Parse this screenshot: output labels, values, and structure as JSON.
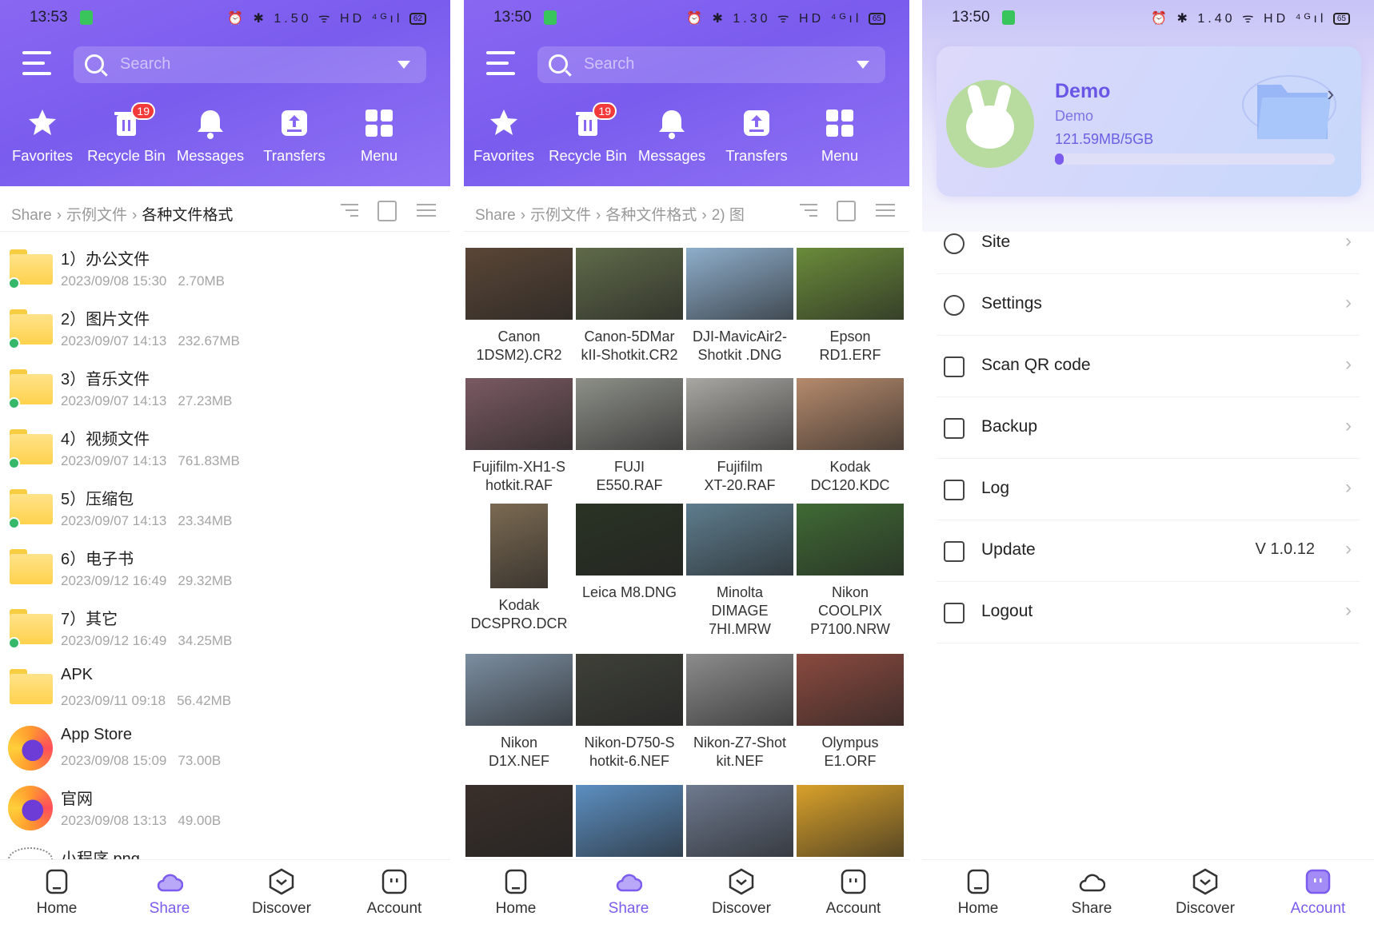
{
  "status1": {
    "time": "13:53",
    "icons": "⏰ ✱ 1.50 ᯤ HD ⁴ᴳıl",
    "battery": "62"
  },
  "status2": {
    "time": "13:50",
    "icons": "⏰ ✱ 1.30 ᯤ HD ⁴ᴳıl",
    "battery": "65"
  },
  "status3": {
    "time": "13:50",
    "icons": "⏰ ✱ 1.40 ᯤ HD ⁴ᴳıl",
    "battery": "65"
  },
  "search": {
    "placeholder": "Search"
  },
  "actions": {
    "favorites": "Favorites",
    "recycle_bin": "Recycle Bin",
    "recycle_badge": "19",
    "messages": "Messages",
    "transfers": "Transfers",
    "menu": "Menu"
  },
  "crumb1": {
    "root": "Share",
    "mid": "示例文件",
    "current": "各种文件格式"
  },
  "crumb2": {
    "root": "Share",
    "mid": "示例文件",
    "mid2": "各种文件格式",
    "current": "2) 图"
  },
  "files": [
    {
      "name": "1）办公文件",
      "date": "2023/09/08 15:30",
      "size": "2.70MB"
    },
    {
      "name": "2）图片文件",
      "date": "2023/09/07 14:13",
      "size": "232.67MB"
    },
    {
      "name": "3）音乐文件",
      "date": "2023/09/07 14:13",
      "size": "27.23MB"
    },
    {
      "name": "4）视频文件",
      "date": "2023/09/07 14:13",
      "size": "761.83MB"
    },
    {
      "name": "5）压缩包",
      "date": "2023/09/07 14:13",
      "size": "23.34MB"
    },
    {
      "name": "6）电子书",
      "date": "2023/09/12 16:49",
      "size": "29.32MB"
    },
    {
      "name": "7）其它",
      "date": "2023/09/12 16:49",
      "size": "34.25MB"
    },
    {
      "name": "APK",
      "date": "2023/09/11 09:18",
      "size": "56.42MB"
    },
    {
      "name": "App Store",
      "date": "2023/09/08 15:09",
      "size": "73.00B"
    },
    {
      "name": "官网",
      "date": "2023/09/08 13:13",
      "size": "49.00B"
    },
    {
      "name": "小程序.png"
    }
  ],
  "images": [
    {
      "l1": "Canon",
      "l2": "1DSM2).CR2",
      "c": "#5a4636"
    },
    {
      "l1": "Canon-5DMar",
      "l2": "kII-Shotkit.CR2",
      "c": "#5f6a49"
    },
    {
      "l1": "DJI-MavicAir2-",
      "l2": "Shotkit .DNG",
      "c": "#8eaecb"
    },
    {
      "l1": "Epson",
      "l2": "RD1.ERF",
      "c": "#6a8b3a"
    },
    {
      "l1": "Fujifilm-XH1-S",
      "l2": "hotkit.RAF",
      "c": "#7a5a62"
    },
    {
      "l1": "FUJI",
      "l2": "E550.RAF",
      "c": "#8d8f88"
    },
    {
      "l1": "Fujifilm",
      "l2": "XT-20.RAF",
      "c": "#a9a7a2"
    },
    {
      "l1": "Kodak",
      "l2": "DC120.KDC",
      "c": "#b58a6c"
    },
    {
      "l1": "Kodak",
      "l2": "DCSPRO.DCR",
      "c": "#7b6a52"
    },
    {
      "l1": "Leica M8.DNG",
      "l2": "",
      "c": "#2a3324"
    },
    {
      "l1": "Minolta",
      "l2": "DIMAGE",
      "l3": "7HI.MRW",
      "c": "#5e7d8e"
    },
    {
      "l1": "Nikon",
      "l2": "COOLPIX",
      "l3": "P7100.NRW",
      "c": "#3f6a34"
    },
    {
      "l1": "Nikon",
      "l2": "D1X.NEF",
      "c": "#7b8ea1"
    },
    {
      "l1": "Nikon-D750-S",
      "l2": "hotkit-6.NEF",
      "c": "#3e4038"
    },
    {
      "l1": "Nikon-Z7-Shot",
      "l2": "kit.NEF",
      "c": "#8c8c8c"
    },
    {
      "l1": "Olympus",
      "l2": "E1.ORF",
      "c": "#8a4a3f"
    },
    {
      "l1": "",
      "l2": "",
      "c": "#3a2f2a"
    },
    {
      "l1": "",
      "l2": "",
      "c": "#5c8fc1"
    },
    {
      "l1": "",
      "l2": "",
      "c": "#6e7a8f"
    },
    {
      "l1": "",
      "l2": "",
      "c": "#d9a12a"
    }
  ],
  "account": {
    "name": "Demo",
    "id": "Demo",
    "quota": "121.59MB/5GB",
    "quota_fraction": 0.024,
    "menu": [
      {
        "label": "Site",
        "icon": "globe-icon"
      },
      {
        "label": "Settings",
        "icon": "settings-icon"
      },
      {
        "label": "Scan QR code",
        "icon": "scan-icon"
      },
      {
        "label": "Backup",
        "icon": "backup-icon"
      },
      {
        "label": "Log",
        "icon": "log-icon"
      },
      {
        "label": "Update",
        "icon": "upload-icon",
        "value": "V 1.0.12"
      },
      {
        "label": "Logout",
        "icon": "logout-icon"
      }
    ]
  },
  "nav": {
    "home": "Home",
    "share": "Share",
    "discover": "Discover",
    "account": "Account"
  },
  "colors": {
    "accent": "#7c5cee",
    "badge": "#f23a3a",
    "folder": "#ffd24d",
    "dot": "#35b86a"
  }
}
